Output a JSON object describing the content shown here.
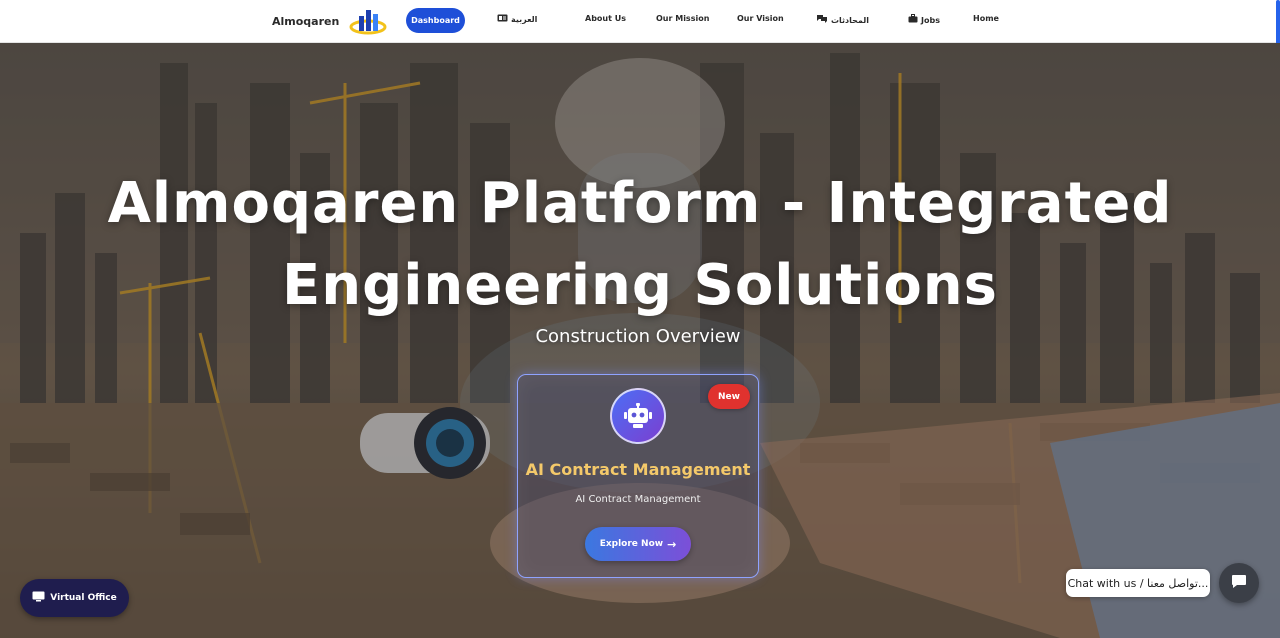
{
  "navbar": {
    "brand": "Almoqaren",
    "dashboard_label": "Dashboard",
    "links": [
      {
        "label": "العربية",
        "icon": "id-card-icon"
      },
      {
        "label": "About Us",
        "icon": ""
      },
      {
        "label": "Our Mission",
        "icon": ""
      },
      {
        "label": "Our Vision",
        "icon": ""
      },
      {
        "label": "المحادثات",
        "icon": "comments-icon"
      },
      {
        "label": "Jobs",
        "icon": "briefcase-icon"
      },
      {
        "label": "Home",
        "icon": ""
      }
    ],
    "accent_color": "#1e4fd8"
  },
  "hero": {
    "title": "Almoqaren Platform - Integrated Engineering Solutions",
    "subtitle": "Construction Overview"
  },
  "card": {
    "badge": "New",
    "icon": "robot-icon",
    "title": "AI Contract Management",
    "description": "AI Contract Management",
    "button_label": "Explore Now"
  },
  "floating": {
    "virtual_office_label": "Virtual Office",
    "chat_text": "Chat with us / تواصل معنا..."
  }
}
